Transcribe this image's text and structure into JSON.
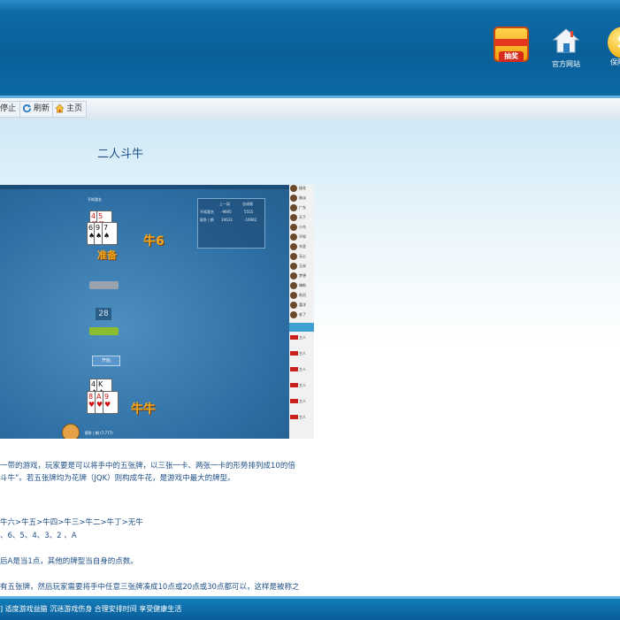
{
  "header": {
    "buttons": [
      {
        "label": "",
        "badge": "抽奖"
      },
      {
        "label": "官方网站"
      },
      {
        "label": "保险"
      }
    ],
    "coin_glyph": "$"
  },
  "toolbar": {
    "stop_label": "停止",
    "refresh_label": "刷新",
    "home_label": "主页"
  },
  "content": {
    "title": "二人斗牛",
    "screenshot": {
      "top_player": "不知我名",
      "score_header": [
        "",
        "上一局",
        "总成绩"
      ],
      "score_rows": [
        [
          "不知我名",
          "-9695",
          "5555"
        ],
        [
          "醉卧 | 鹤",
          "10633",
          "-10982"
        ]
      ],
      "top_cards": [
        {
          "rank": "4",
          "suit": "♥",
          "red": true
        },
        {
          "rank": "5",
          "suit": "♥",
          "red": true
        },
        {
          "rank": "6",
          "suit": "♠",
          "red": false
        },
        {
          "rank": "9",
          "suit": "♠",
          "red": false
        },
        {
          "rank": "7",
          "suit": "♠",
          "red": false
        }
      ],
      "top_status": "准备",
      "top_result": "牛6",
      "timer": "28",
      "start_button": "开始",
      "bottom_cards": [
        {
          "rank": "4",
          "suit": "♠",
          "red": false
        },
        {
          "rank": "K",
          "suit": "♠",
          "red": false
        },
        {
          "rank": "8",
          "suit": "♥",
          "red": true
        },
        {
          "rank": "A",
          "suit": "♥",
          "red": true
        },
        {
          "rank": "9",
          "suit": "♥",
          "red": true
        }
      ],
      "bottom_result": "牛牛",
      "bottom_player": "醉卧 | 鹤 (7,777)",
      "chat_names": [
        "接花",
        "暗淡",
        "广东",
        "天下",
        "小鸟",
        "不知",
        "东里",
        "无心",
        "玉米",
        "梦想",
        "嗨哟",
        "秋风",
        "喜洋",
        "老了"
      ],
      "chat_tag": "主人"
    },
    "paragraphs": [
      "一带的游戏，玩家要是可以将手中的五张牌，以三张一卡、两张一卡的形势排列成10的倍",
      "斗牛”。若五张牌均为花牌（JQK）则构成牛花，是游戏中最大的牌型。",
      "牛六>牛五>牛四>牛三>牛二>牛丁>无牛",
      "、6、5、4、3、2 、A",
      "后A是当1点，其他的牌型当自身的点数。",
      "有五张牌，然后玩家需要将手中任意三张牌凑成10点或20点或30点都可以，这样是被称之"
    ]
  },
  "footer": {
    "text": "] 适度游戏益脑 沉迷游戏伤身 合理安排时间 享受健康生活"
  }
}
